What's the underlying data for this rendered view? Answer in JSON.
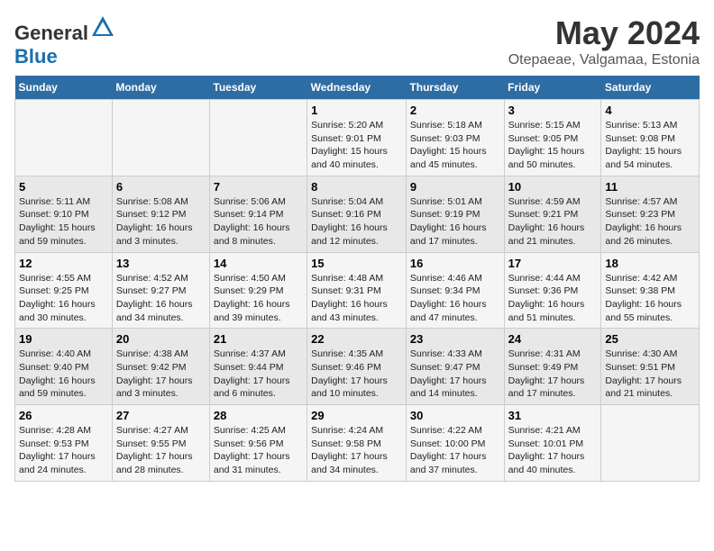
{
  "header": {
    "logo_general": "General",
    "logo_blue": "Blue",
    "title": "May 2024",
    "subtitle": "Otepaeae, Valgamaa, Estonia"
  },
  "days_of_week": [
    "Sunday",
    "Monday",
    "Tuesday",
    "Wednesday",
    "Thursday",
    "Friday",
    "Saturday"
  ],
  "weeks": [
    [
      {
        "day": "",
        "info": ""
      },
      {
        "day": "",
        "info": ""
      },
      {
        "day": "",
        "info": ""
      },
      {
        "day": "1",
        "info": "Sunrise: 5:20 AM\nSunset: 9:01 PM\nDaylight: 15 hours and 40 minutes."
      },
      {
        "day": "2",
        "info": "Sunrise: 5:18 AM\nSunset: 9:03 PM\nDaylight: 15 hours and 45 minutes."
      },
      {
        "day": "3",
        "info": "Sunrise: 5:15 AM\nSunset: 9:05 PM\nDaylight: 15 hours and 50 minutes."
      },
      {
        "day": "4",
        "info": "Sunrise: 5:13 AM\nSunset: 9:08 PM\nDaylight: 15 hours and 54 minutes."
      }
    ],
    [
      {
        "day": "5",
        "info": "Sunrise: 5:11 AM\nSunset: 9:10 PM\nDaylight: 15 hours and 59 minutes."
      },
      {
        "day": "6",
        "info": "Sunrise: 5:08 AM\nSunset: 9:12 PM\nDaylight: 16 hours and 3 minutes."
      },
      {
        "day": "7",
        "info": "Sunrise: 5:06 AM\nSunset: 9:14 PM\nDaylight: 16 hours and 8 minutes."
      },
      {
        "day": "8",
        "info": "Sunrise: 5:04 AM\nSunset: 9:16 PM\nDaylight: 16 hours and 12 minutes."
      },
      {
        "day": "9",
        "info": "Sunrise: 5:01 AM\nSunset: 9:19 PM\nDaylight: 16 hours and 17 minutes."
      },
      {
        "day": "10",
        "info": "Sunrise: 4:59 AM\nSunset: 9:21 PM\nDaylight: 16 hours and 21 minutes."
      },
      {
        "day": "11",
        "info": "Sunrise: 4:57 AM\nSunset: 9:23 PM\nDaylight: 16 hours and 26 minutes."
      }
    ],
    [
      {
        "day": "12",
        "info": "Sunrise: 4:55 AM\nSunset: 9:25 PM\nDaylight: 16 hours and 30 minutes."
      },
      {
        "day": "13",
        "info": "Sunrise: 4:52 AM\nSunset: 9:27 PM\nDaylight: 16 hours and 34 minutes."
      },
      {
        "day": "14",
        "info": "Sunrise: 4:50 AM\nSunset: 9:29 PM\nDaylight: 16 hours and 39 minutes."
      },
      {
        "day": "15",
        "info": "Sunrise: 4:48 AM\nSunset: 9:31 PM\nDaylight: 16 hours and 43 minutes."
      },
      {
        "day": "16",
        "info": "Sunrise: 4:46 AM\nSunset: 9:34 PM\nDaylight: 16 hours and 47 minutes."
      },
      {
        "day": "17",
        "info": "Sunrise: 4:44 AM\nSunset: 9:36 PM\nDaylight: 16 hours and 51 minutes."
      },
      {
        "day": "18",
        "info": "Sunrise: 4:42 AM\nSunset: 9:38 PM\nDaylight: 16 hours and 55 minutes."
      }
    ],
    [
      {
        "day": "19",
        "info": "Sunrise: 4:40 AM\nSunset: 9:40 PM\nDaylight: 16 hours and 59 minutes."
      },
      {
        "day": "20",
        "info": "Sunrise: 4:38 AM\nSunset: 9:42 PM\nDaylight: 17 hours and 3 minutes."
      },
      {
        "day": "21",
        "info": "Sunrise: 4:37 AM\nSunset: 9:44 PM\nDaylight: 17 hours and 6 minutes."
      },
      {
        "day": "22",
        "info": "Sunrise: 4:35 AM\nSunset: 9:46 PM\nDaylight: 17 hours and 10 minutes."
      },
      {
        "day": "23",
        "info": "Sunrise: 4:33 AM\nSunset: 9:47 PM\nDaylight: 17 hours and 14 minutes."
      },
      {
        "day": "24",
        "info": "Sunrise: 4:31 AM\nSunset: 9:49 PM\nDaylight: 17 hours and 17 minutes."
      },
      {
        "day": "25",
        "info": "Sunrise: 4:30 AM\nSunset: 9:51 PM\nDaylight: 17 hours and 21 minutes."
      }
    ],
    [
      {
        "day": "26",
        "info": "Sunrise: 4:28 AM\nSunset: 9:53 PM\nDaylight: 17 hours and 24 minutes."
      },
      {
        "day": "27",
        "info": "Sunrise: 4:27 AM\nSunset: 9:55 PM\nDaylight: 17 hours and 28 minutes."
      },
      {
        "day": "28",
        "info": "Sunrise: 4:25 AM\nSunset: 9:56 PM\nDaylight: 17 hours and 31 minutes."
      },
      {
        "day": "29",
        "info": "Sunrise: 4:24 AM\nSunset: 9:58 PM\nDaylight: 17 hours and 34 minutes."
      },
      {
        "day": "30",
        "info": "Sunrise: 4:22 AM\nSunset: 10:00 PM\nDaylight: 17 hours and 37 minutes."
      },
      {
        "day": "31",
        "info": "Sunrise: 4:21 AM\nSunset: 10:01 PM\nDaylight: 17 hours and 40 minutes."
      },
      {
        "day": "",
        "info": ""
      }
    ]
  ]
}
